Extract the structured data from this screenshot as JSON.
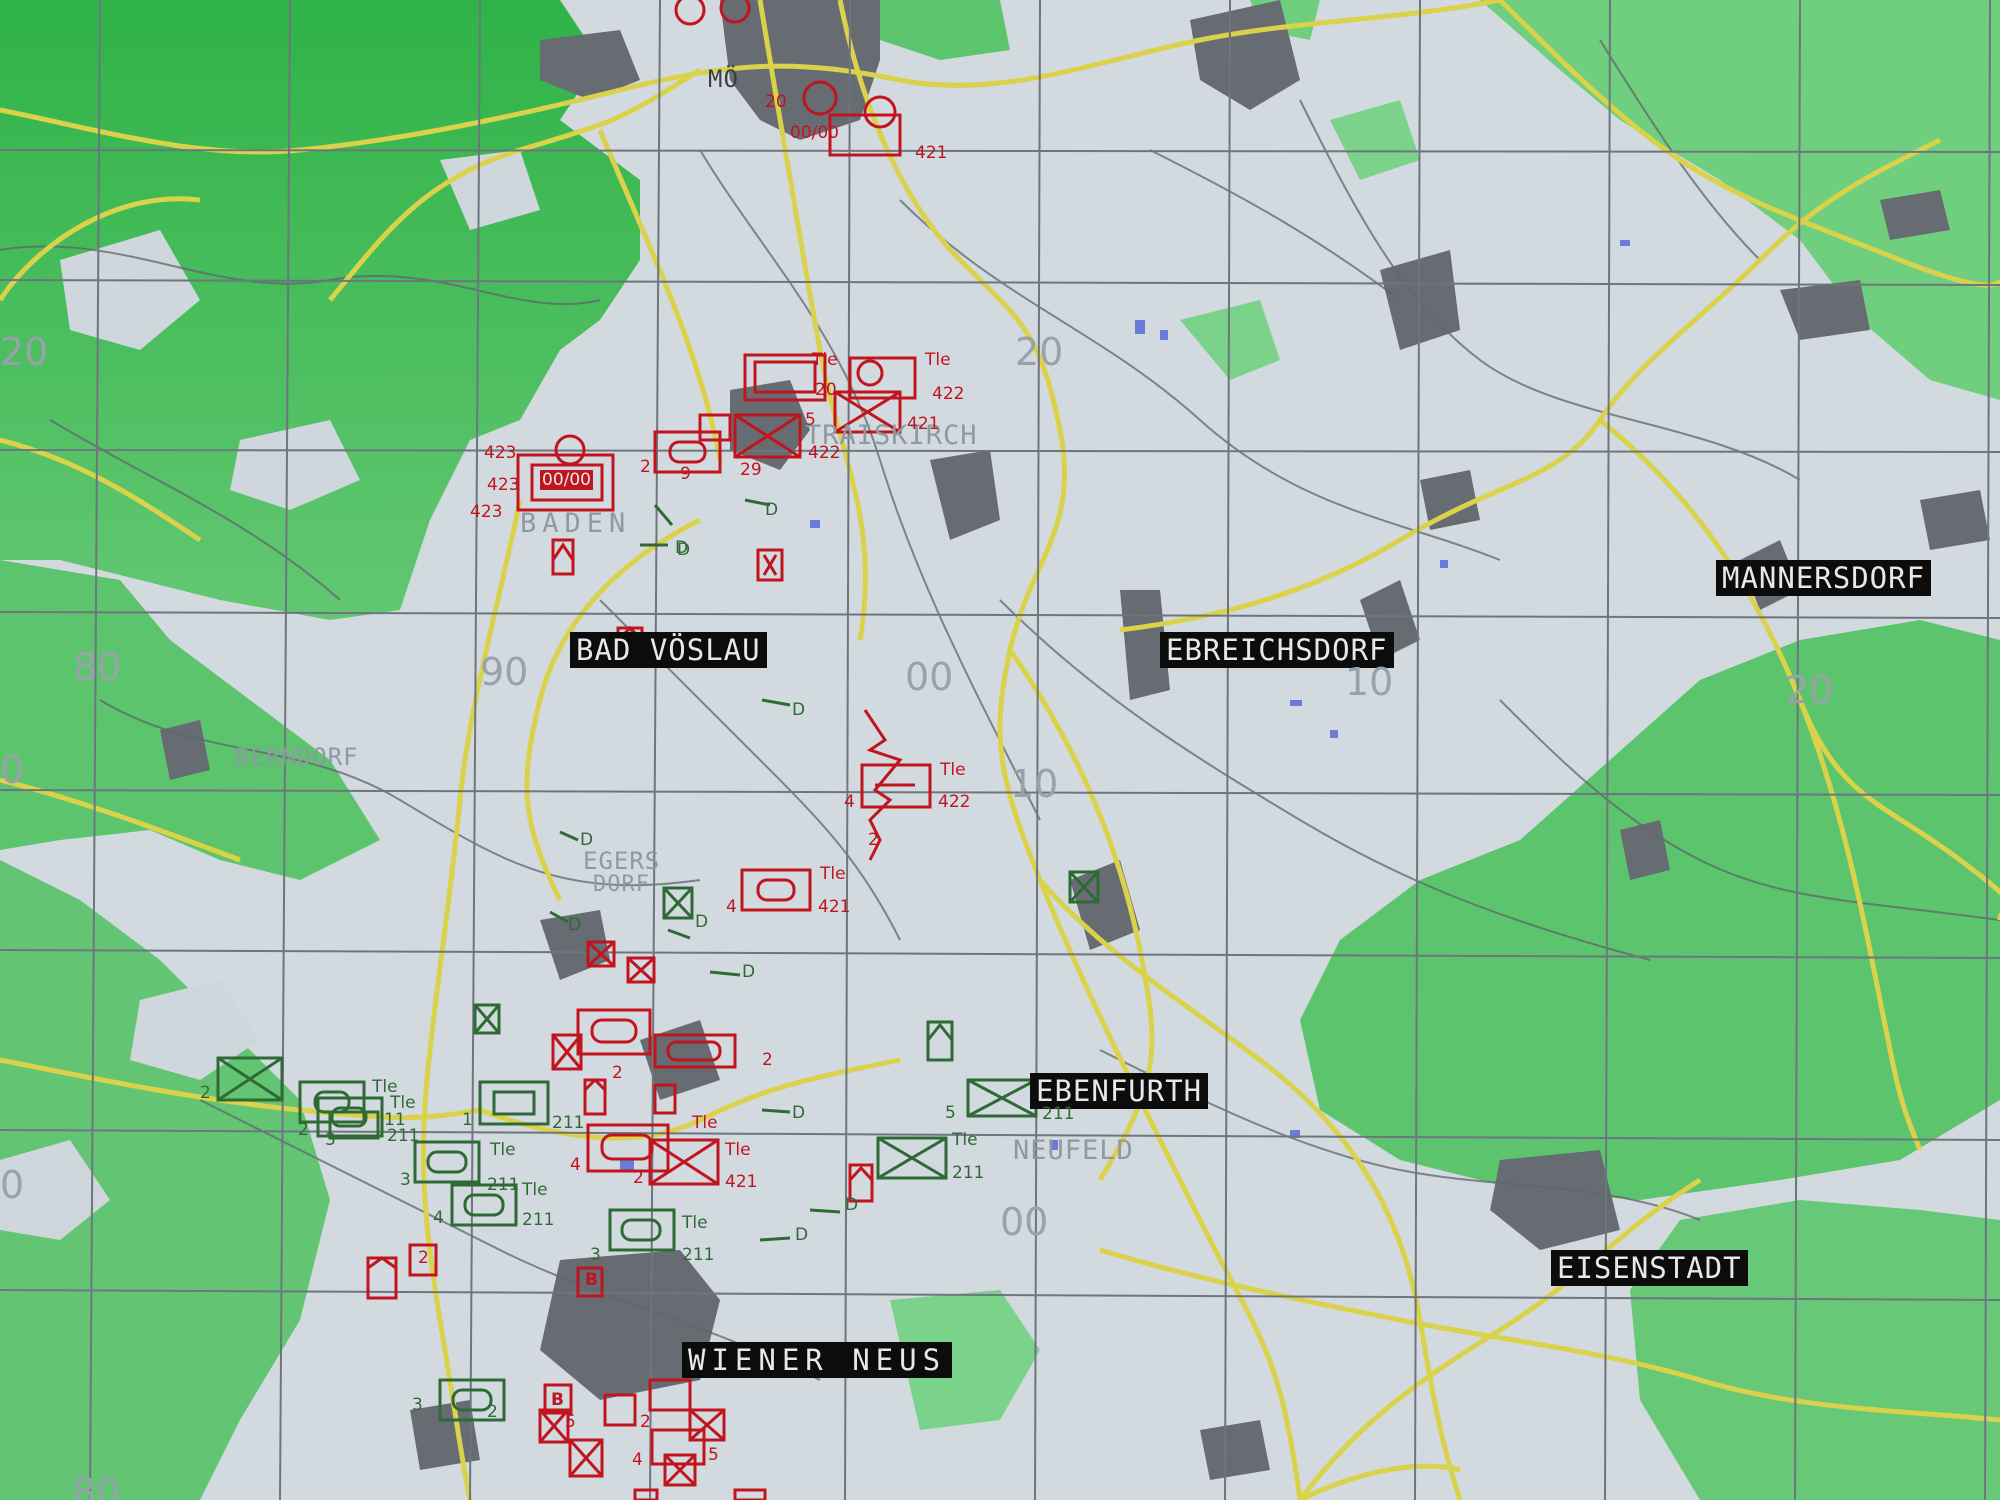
{
  "map": {
    "towns": [
      {
        "id": "baden",
        "label": "BADEN",
        "style": "plain"
      },
      {
        "id": "traiskirchen",
        "label": "TRAISKIRCH",
        "style": "plain"
      },
      {
        "id": "bad-voeslau",
        "label": "BAD VÖSLAU",
        "style": "boxed"
      },
      {
        "id": "ebreichsdorf",
        "label": "EBREICHSDORF",
        "style": "boxed"
      },
      {
        "id": "mannersdorf",
        "label": "MANNERSDORF",
        "style": "boxed"
      },
      {
        "id": "berndorf",
        "label": "BERNDORF",
        "style": "plain"
      },
      {
        "id": "eberfurth",
        "label": "EBENFURTH",
        "style": "boxed"
      },
      {
        "id": "neufeld",
        "label": "NEUFELD",
        "style": "plain"
      },
      {
        "id": "eisenstadt",
        "label": "EISENSTADT",
        "style": "boxed"
      },
      {
        "id": "wiener-neustadt",
        "label": "WIENER NEUS",
        "style": "boxed"
      },
      {
        "id": "moedling",
        "label": "MÖ",
        "style": "plain"
      },
      {
        "id": "eggersdorf-a",
        "label": "EGERS",
        "style": "plain"
      },
      {
        "id": "eggersdorf-b",
        "label": "DORF",
        "style": "plain"
      }
    ],
    "grid_labels": [
      "20",
      "20",
      "80",
      "90",
      "00",
      "10",
      "10",
      "20",
      "00",
      "0",
      "0",
      "80"
    ],
    "unit_labels": {
      "tle": "Tle",
      "n421": "421",
      "n422": "422",
      "n423": "423",
      "n211": "211",
      "n11": "11",
      "n2": "2",
      "n3": "3",
      "n4": "4",
      "n5": "5",
      "n1": "1",
      "d": "D",
      "b": "B",
      "hq": "00/00",
      "n9": "9",
      "n29": "29",
      "n20": "20"
    },
    "colors": {
      "forest": "#3fb050",
      "forest_light": "#6fcf7e",
      "open": "#d3dadf",
      "settlement": "#6b7076",
      "road_major": "#d9d24a",
      "road_minor": "#5e666c",
      "grid": "#6d767e",
      "hostile": "#c0141e",
      "friendly": "#2f6a36"
    }
  }
}
